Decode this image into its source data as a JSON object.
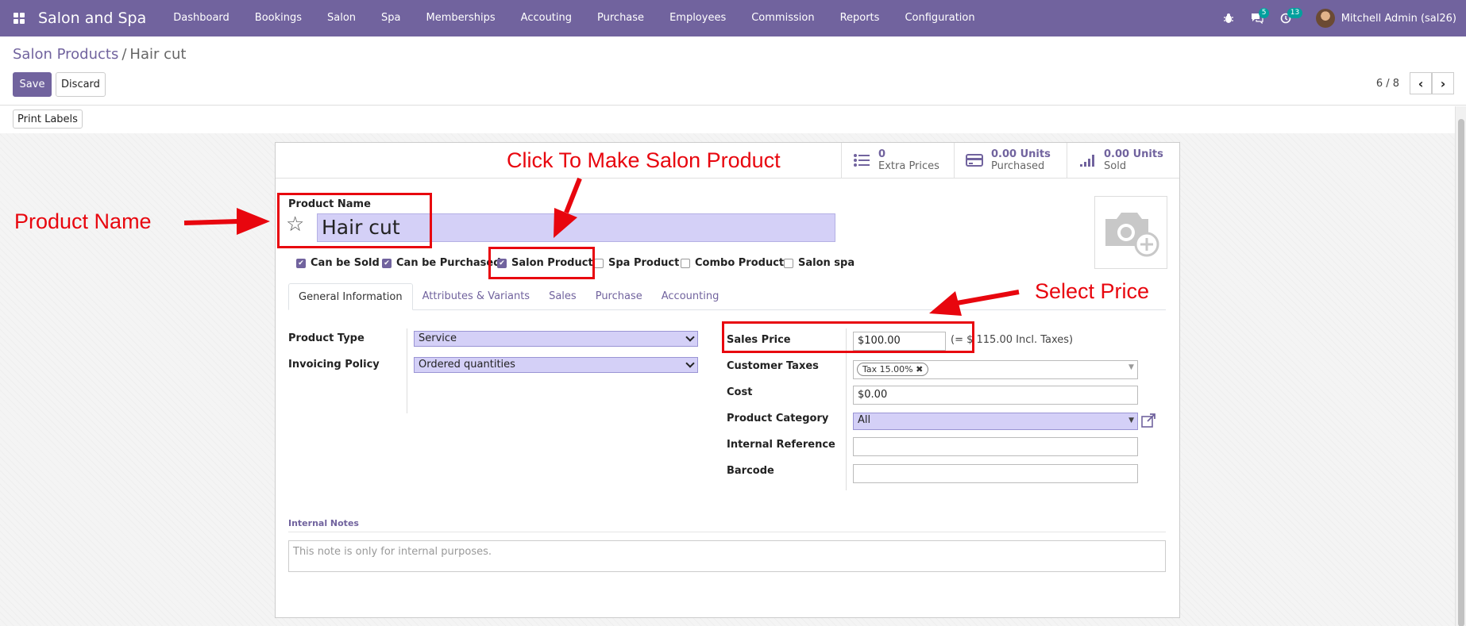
{
  "navbar": {
    "app_title": "Salon and Spa",
    "menu": [
      "Dashboard",
      "Bookings",
      "Salon",
      "Spa",
      "Memberships",
      "Accouting",
      "Purchase",
      "Employees",
      "Commission",
      "Reports",
      "Configuration"
    ],
    "messages_badge": "5",
    "activities_badge": "13",
    "user_name": "Mitchell Admin (sal26)"
  },
  "breadcrumb": {
    "parent": "Salon Products",
    "separator": "/",
    "current": "Hair cut"
  },
  "buttons": {
    "save": "Save",
    "discard": "Discard",
    "print_labels": "Print Labels"
  },
  "pager": {
    "value": "6 / 8"
  },
  "stats": [
    {
      "value": "0",
      "label": "Extra Prices"
    },
    {
      "value": "0.00 Units",
      "label": "Purchased"
    },
    {
      "value": "0.00 Units",
      "label": "Sold"
    }
  ],
  "product": {
    "name_label": "Product Name",
    "name": "Hair cut",
    "checkboxes": [
      {
        "label": "Can be Sold",
        "checked": true
      },
      {
        "label": "Can be Purchased",
        "checked": true
      },
      {
        "label": "Salon Product",
        "checked": true
      },
      {
        "label": "Spa Product",
        "checked": false
      },
      {
        "label": "Combo Product",
        "checked": false
      },
      {
        "label": "Salon spa",
        "checked": false
      }
    ]
  },
  "tabs": [
    "General Information",
    "Attributes & Variants",
    "Sales",
    "Purchase",
    "Accounting"
  ],
  "general": {
    "product_type_label": "Product Type",
    "product_type": "Service",
    "invoicing_policy_label": "Invoicing Policy",
    "invoicing_policy": "Ordered quantities",
    "sales_price_label": "Sales Price",
    "sales_price": "$100.00",
    "sales_price_incl": "(= $ 115.00 Incl. Taxes)",
    "customer_taxes_label": "Customer Taxes",
    "customer_tax_tag": "Tax 15.00%",
    "cost_label": "Cost",
    "cost": "$0.00",
    "category_label": "Product Category",
    "category": "All",
    "internal_ref_label": "Internal Reference",
    "internal_ref": "",
    "barcode_label": "Barcode",
    "barcode": ""
  },
  "notes": {
    "title": "Internal Notes",
    "placeholder": "This note is only for internal purposes."
  },
  "annotations": {
    "product_name": "Product Name",
    "salon_product": "Click To Make Salon Product",
    "select_price": "Select Price",
    "color": "#e8060e"
  },
  "colors": {
    "brand": "#71639e",
    "field_bg": "#d4d0f7"
  }
}
